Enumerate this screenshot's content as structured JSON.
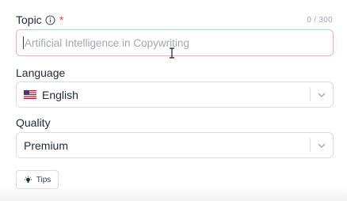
{
  "topic": {
    "label": "Topic",
    "required_mark": "*",
    "char_count": "0 / 300",
    "placeholder": "Artificial Intelligence in Copywriting",
    "value": "",
    "icon": "info-icon"
  },
  "language": {
    "label": "Language",
    "selected": "English",
    "flag_icon": "us-flag-icon"
  },
  "quality": {
    "label": "Quality",
    "selected": "Premium"
  },
  "tips": {
    "label": "Tips",
    "icon": "lightbulb-icon"
  },
  "colors": {
    "required": "#ef4444",
    "focused_border": "#f0b3bb",
    "border": "#d9dce1",
    "placeholder": "#a3a7ae"
  }
}
